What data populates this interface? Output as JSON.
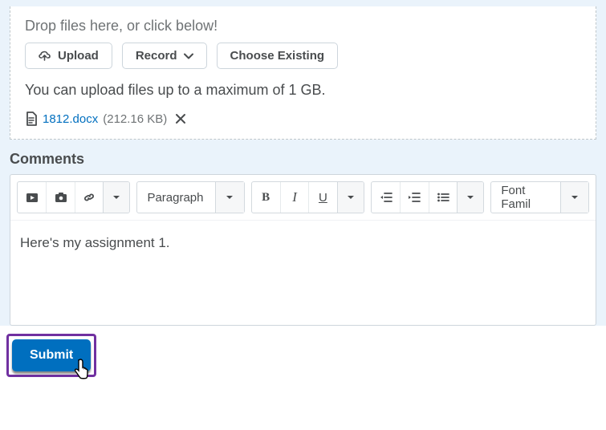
{
  "dropzone": {
    "prompt": "Drop files here, or click below!",
    "upload_label": "Upload",
    "record_label": "Record",
    "choose_label": "Choose Existing",
    "hint": "You can upload files up to a maximum of 1 GB."
  },
  "file": {
    "name": "1812.docx",
    "size": "(212.16 KB)"
  },
  "comments": {
    "label": "Comments",
    "paragraph_label": "Paragraph",
    "font_family_label": "Font Famil",
    "body": "Here's my assignment 1."
  },
  "submit": {
    "label": "Submit"
  }
}
